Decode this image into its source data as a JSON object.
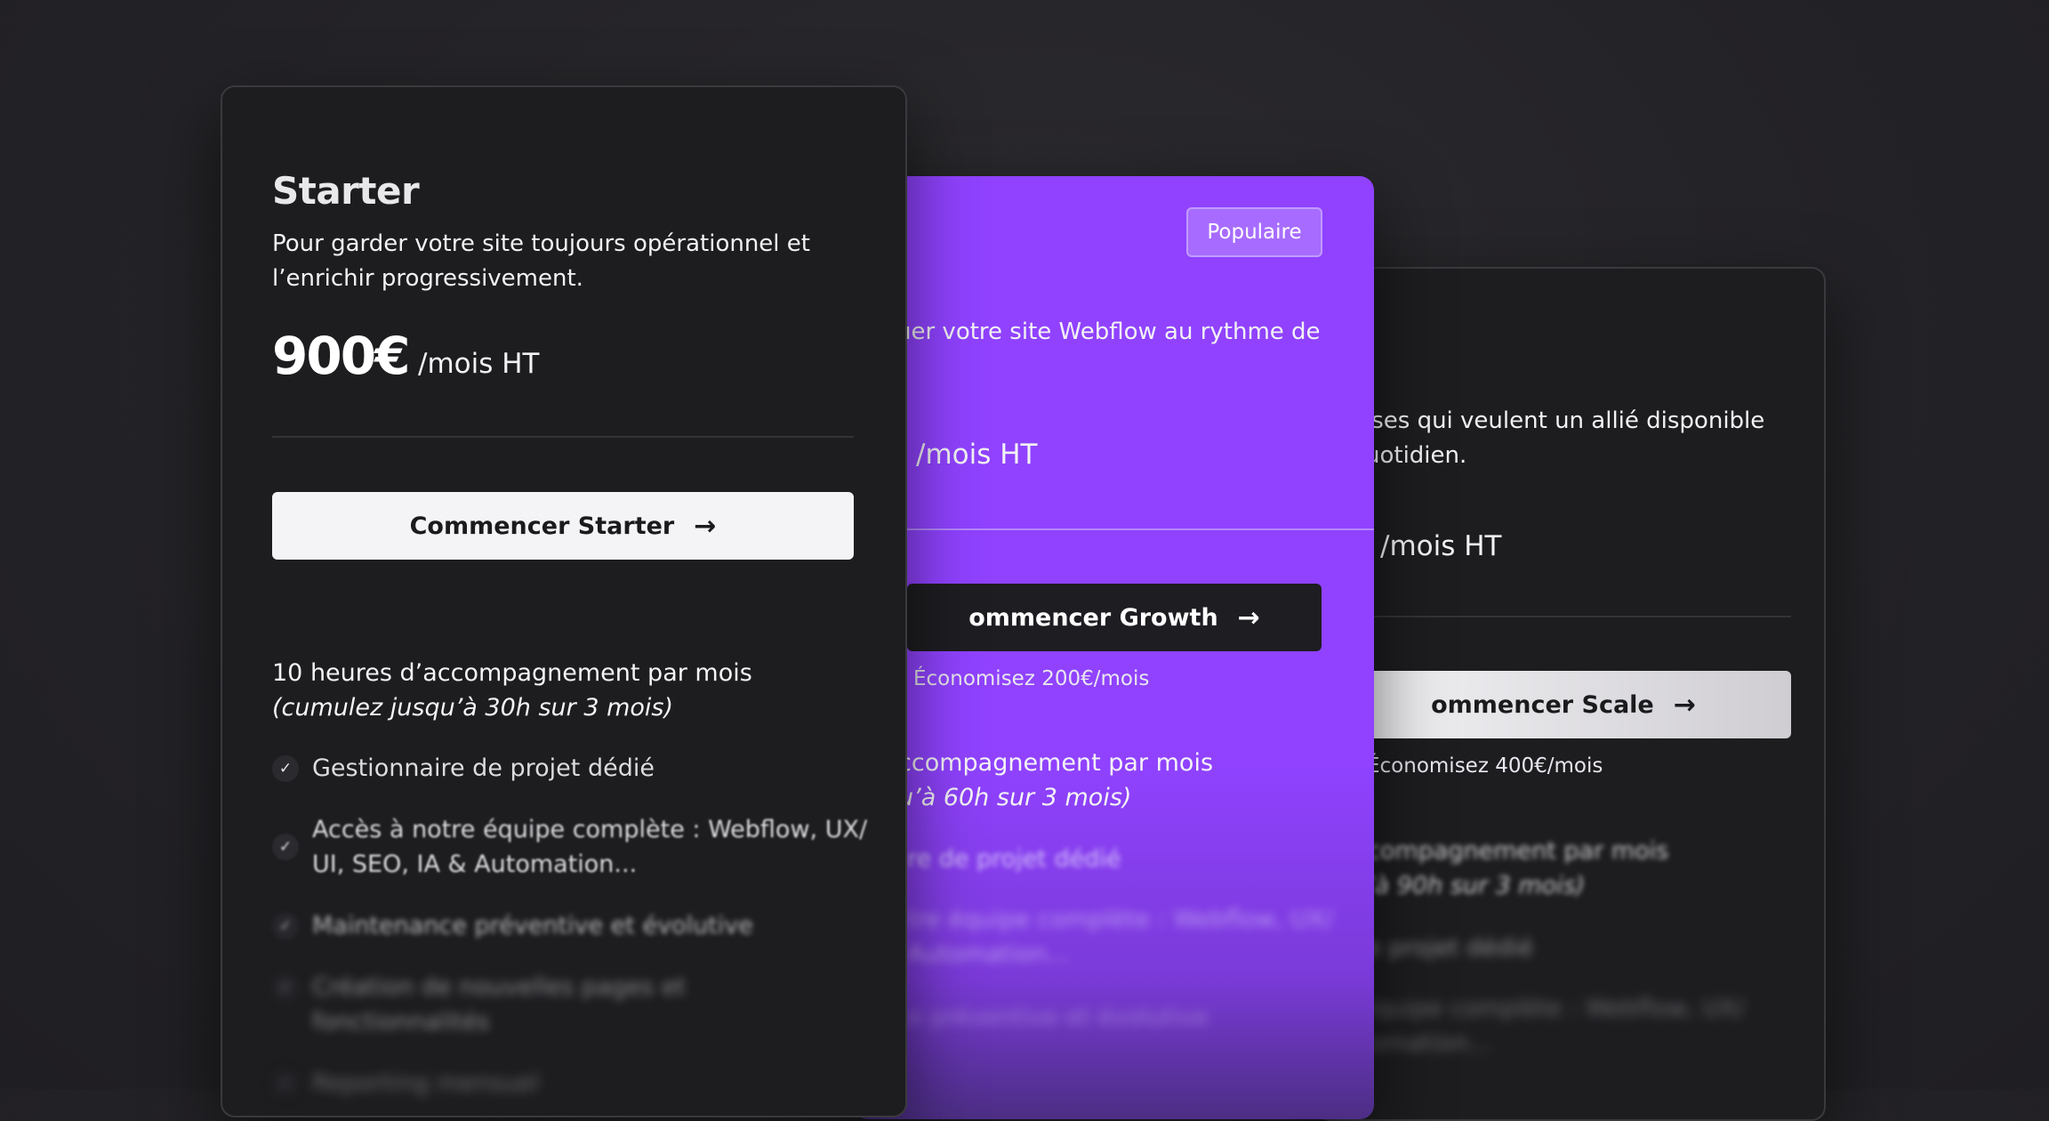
{
  "scale": {
    "desc_lines": [
      "ises qui veulent un allié disponible",
      "uotidien."
    ],
    "period": "/mois HT",
    "cta": "ommencer Scale",
    "saving": "Économisez 400€/mois",
    "hours_line1": "compagnement par mois",
    "hours_line2": "’à 90h sur 3 mois)",
    "features": [
      "e de projet dédié",
      "re équipe complète : Webflow, UX/",
      "Automation..."
    ]
  },
  "growth": {
    "badge": "Populaire",
    "desc": "uer votre site Webflow au rythme de",
    "period": "/mois HT",
    "cta": "ommencer Growth",
    "saving": "Économisez 200€/mois",
    "hours_line1": "ccompagnement par mois",
    "hours_line2": "u’à 60h sur 3 mois)",
    "features": [
      "re de projet dédié",
      "tre équipe complète : Webflow, UX/",
      "Automation...",
      "e préventive et évolutive"
    ]
  },
  "starter": {
    "title": "Starter",
    "desc_lines": [
      "Pour garder votre site toujours opérationnel et",
      "l’enrichir progressivement."
    ],
    "price": "900€",
    "period": "/mois HT",
    "cta": "Commencer Starter",
    "hours_line1": "10 heures d’accompagnement par mois",
    "hours_line2": "(cumulez jusqu’à 30h sur 3 mois)",
    "features": [
      "Gestionnaire de projet dédié",
      "Accès à notre équipe complète : Webflow, UX/ UI, SEO, IA & Automation...",
      "Maintenance préventive et évolutive",
      "Création de nouvelles pages et fonctionnalités",
      "Reporting mensuel"
    ]
  },
  "icons": {
    "arrow": "→",
    "check": "✓"
  },
  "colors": {
    "accent": "#9042ff",
    "card_dark": "#1d1d20",
    "background": "#232226"
  }
}
